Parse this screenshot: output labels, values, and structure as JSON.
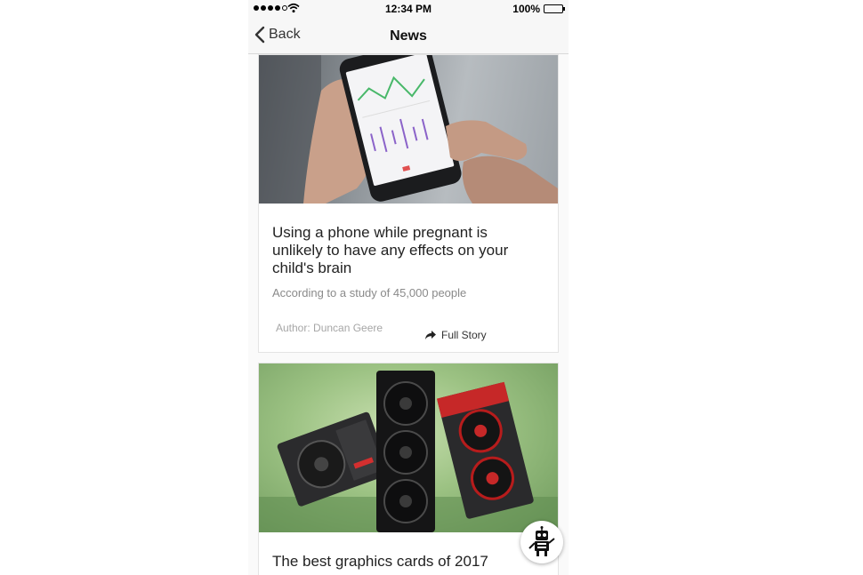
{
  "status_bar": {
    "time": "12:34 PM",
    "battery": "100%",
    "signal_bars_filled": 4,
    "signal_bars_total": 5
  },
  "nav": {
    "back_label": "Back",
    "title": "News"
  },
  "articles": [
    {
      "headline": "Using a phone while pregnant is unlikely to have any effects on your child's brain",
      "subtitle": "According to a study of 45,000 people",
      "author": "Author: Duncan Geere",
      "action_label": "Full Story"
    },
    {
      "headline": "The best graphics cards of 2017"
    }
  ],
  "icons": {
    "back": "chevron-left-icon",
    "share": "share-arrow-icon",
    "wifi": "wifi-icon",
    "battery": "battery-icon",
    "bot": "robot-icon"
  },
  "colors": {
    "nav_background": "#f7f7f7",
    "card_border": "#e4e4e4",
    "headline_text": "#222222",
    "meta_text": "#8a8a8a"
  }
}
